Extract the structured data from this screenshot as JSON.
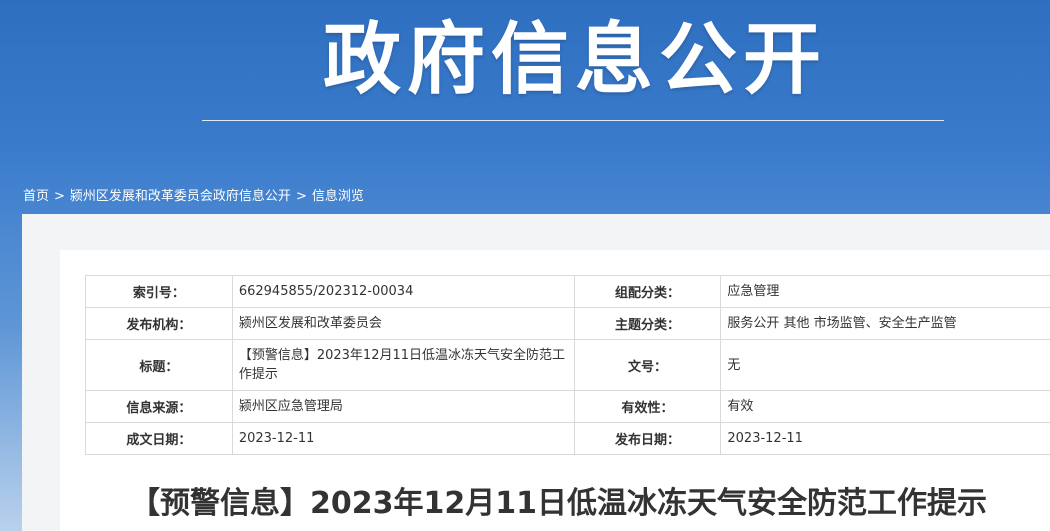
{
  "banner": {
    "title": "政府信息公开"
  },
  "breadcrumb": {
    "home": "首页",
    "separator": ">",
    "level1": "颍州区发展和改革委员会政府信息公开",
    "level2": "信息浏览"
  },
  "meta_table": {
    "rows": [
      {
        "l1": "索引号：",
        "v1": "662945855/202312-00034",
        "l2": "组配分类：",
        "v2": "应急管理"
      },
      {
        "l1": "发布机构：",
        "v1": "颍州区发展和改革委员会",
        "l2": "主题分类：",
        "v2": "服务公开  其他  市场监管、安全生产监管"
      },
      {
        "l1": "标题：",
        "v1": "【预警信息】2023年12月11日低温冰冻天气安全防范工作提示",
        "l2": "文号：",
        "v2": "无"
      },
      {
        "l1": "信息来源：",
        "v1": "颍州区应急管理局",
        "l2": "有效性：",
        "v2": "有效"
      },
      {
        "l1": "成文日期：",
        "v1": "2023-12-11",
        "l2": "发布日期：",
        "v2": "2023-12-11"
      }
    ]
  },
  "article": {
    "title": "【预警信息】2023年12月11日低温冰冻天气安全防范工作提示"
  },
  "colors": {
    "banner_top": "#2f6fc0",
    "banner_bottom": "#b9d1ec",
    "text": "#333333",
    "border": "#d9d9d9"
  }
}
